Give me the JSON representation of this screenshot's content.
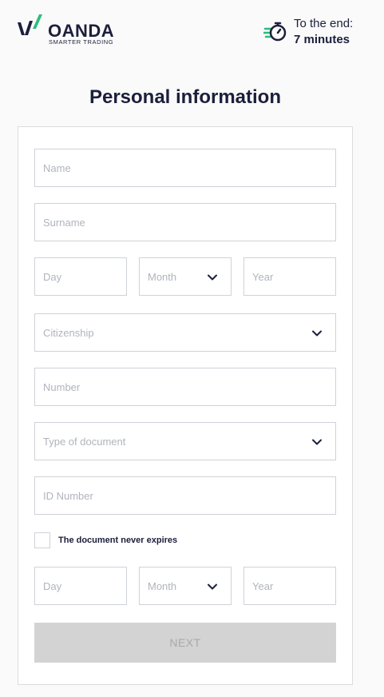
{
  "header": {
    "logo_word": "OANDA",
    "logo_tagline": "SMARTER TRADING",
    "timer_label": "To the end:",
    "timer_value": "7 minutes"
  },
  "page": {
    "title": "Personal information"
  },
  "form": {
    "name_placeholder": "Name",
    "surname_placeholder": "Surname",
    "birth_day_placeholder": "Day",
    "birth_month_placeholder": "Month",
    "birth_year_placeholder": "Year",
    "citizenship_placeholder": "Citizenship",
    "number_placeholder": "Number",
    "document_type_placeholder": "Type of document",
    "id_number_placeholder": "ID Number",
    "never_expires_label": "The document never expires",
    "never_expires_checked": false,
    "expiry_day_placeholder": "Day",
    "expiry_month_placeholder": "Month",
    "expiry_year_placeholder": "Year",
    "next_label": "NEXT"
  },
  "colors": {
    "brand_dark": "#1b1f3b",
    "brand_green": "#2bbd7e",
    "button_disabled_bg": "#d3d3d3",
    "placeholder": "#b0b4bd"
  },
  "icons": {
    "logo": "oanda-logo-icon",
    "timer": "stopwatch-icon",
    "dropdown": "chevron-down-icon"
  }
}
